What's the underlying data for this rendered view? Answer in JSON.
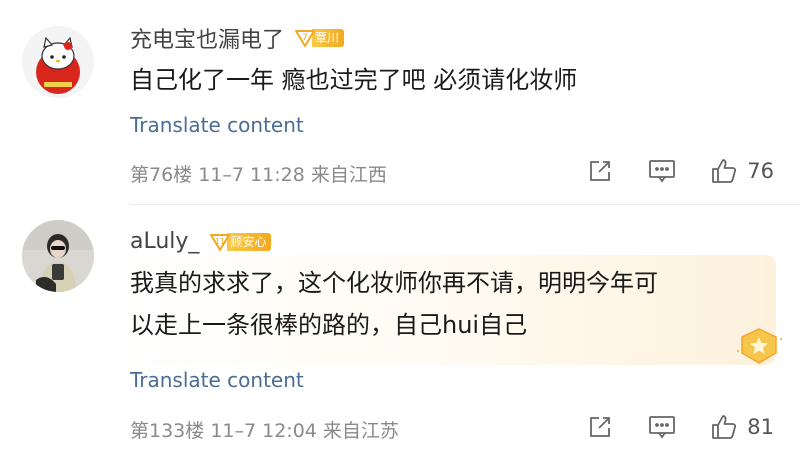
{
  "comments": [
    {
      "username": "充电宝也漏电了",
      "fan_level": "7",
      "fan_group": "覃川",
      "content": "自己化了一年 瘾也过完了吧 必须请化妆师",
      "translate_label": "Translate content",
      "floor": "第76楼",
      "date": "11–7 11:28",
      "location": "来自江西",
      "like_count": "76",
      "avatar_icon": "hello-kitty-avatar"
    },
    {
      "username": "aLuly_",
      "fan_level": "11",
      "fan_group": "顾安心",
      "content_line1": "我真的求求了，这个化妆师你再不请，明明今年可",
      "content_line2": "以走上一条很棒的路的，自己hui自己",
      "translate_label": "Translate content",
      "floor": "第133楼",
      "date": "11–7 12:04",
      "location": "来自江苏",
      "like_count": "81",
      "avatar_icon": "girl-photo-avatar"
    }
  ],
  "colors": {
    "link": "#4a6d96",
    "badge": "#f3a91f",
    "meta": "#8a8a8a"
  },
  "icons": [
    "share-icon",
    "comment-icon",
    "like-icon",
    "star-badge-icon"
  ]
}
